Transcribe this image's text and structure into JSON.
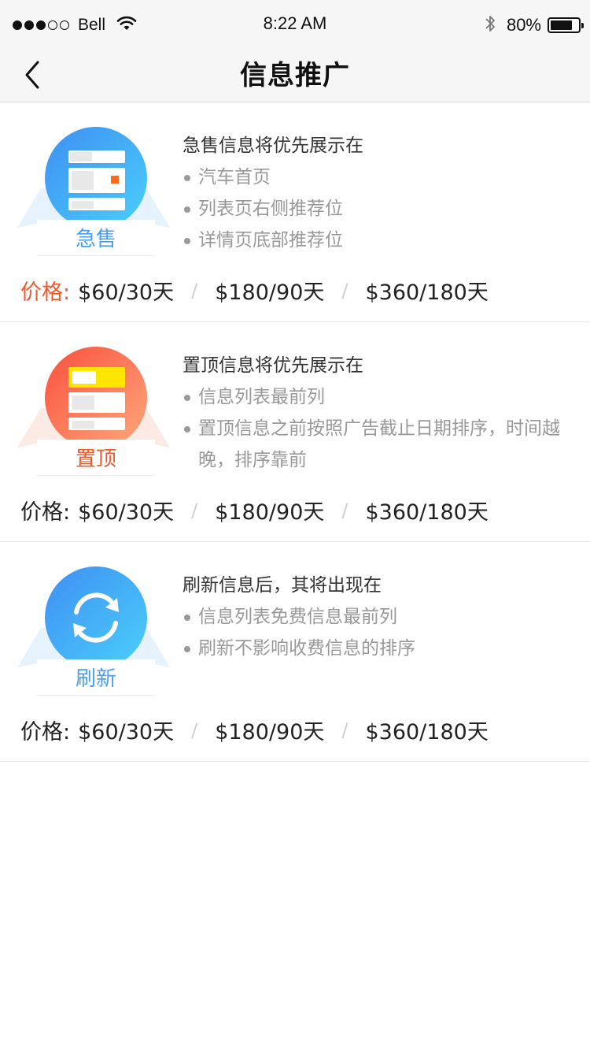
{
  "status_bar": {
    "carrier": "Bell",
    "time": "8:22 AM",
    "battery_percent": "80%",
    "battery_level": 0.8,
    "signal_bars_filled": 3,
    "signal_bars_total": 5
  },
  "nav": {
    "title": "信息推广",
    "back_icon": "chevron-left-icon"
  },
  "cards": [
    {
      "badge_label": "急售",
      "badge_color": "#4a9ef0",
      "title": "急售信息将优先展示在",
      "items": [
        "汽车首页",
        "列表页右侧推荐位",
        "详情页底部推荐位"
      ],
      "price_label": "价格:",
      "price_label_color": "#ef5a2c",
      "prices": [
        "$60/30天",
        "$180/90天",
        "$360/180天"
      ]
    },
    {
      "badge_label": "置顶",
      "badge_color": "#ef5a2c",
      "title": "置顶信息将优先展示在",
      "items": [
        "信息列表最前列",
        "置顶信息之前按照广告截止日期排序，时间越晚，排序靠前"
      ],
      "price_label": "价格:",
      "price_label_color": "#222222",
      "prices": [
        "$60/30天",
        "$180/90天",
        "$360/180天"
      ]
    },
    {
      "badge_label": "刷新",
      "badge_color": "#4a9ef0",
      "title": "刷新信息后，其将出现在",
      "items": [
        "信息列表免费信息最前列",
        "刷新不影响收费信息的排序"
      ],
      "price_label": "价格:",
      "price_label_color": "#222222",
      "prices": [
        "$60/30天",
        "$180/90天",
        "$360/180天"
      ]
    }
  ]
}
